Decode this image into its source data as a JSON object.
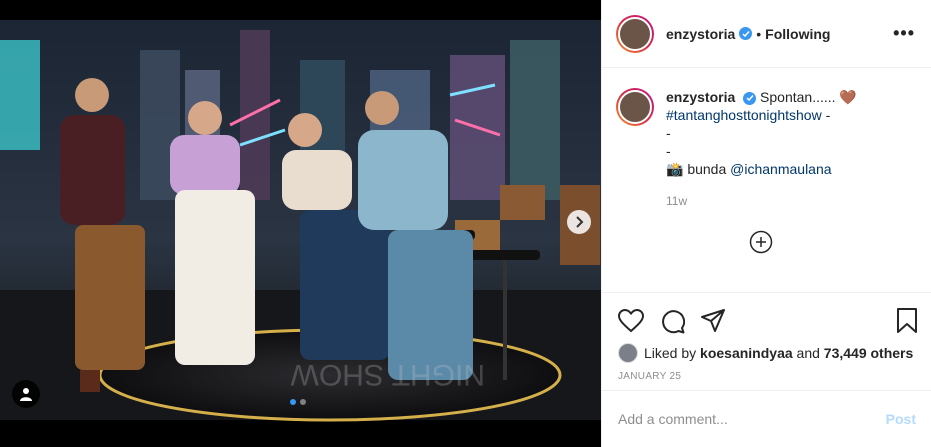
{
  "header": {
    "username": "enzystoria",
    "separator": "•",
    "follow_state": "Following",
    "more_label": "•••"
  },
  "caption": {
    "username": "enzystoria",
    "text": "Spontan......",
    "emoji": "🤎",
    "hashtag": "#tantanghosttonightshow",
    "dash1": "-",
    "dash2": "-",
    "dash3": "-",
    "camera_emoji": "📸",
    "credit_text": "bunda",
    "mention": "@ichanmaulana",
    "time_ago": "11w"
  },
  "likes": {
    "prefix": "Liked by",
    "user": "koesanindyaa",
    "and_text": "and",
    "count": "73,449 others"
  },
  "post_date": "JANUARY 25",
  "comment": {
    "placeholder": "Add a comment...",
    "post_label": "Post"
  },
  "carousel": {
    "total": 2,
    "active_index": 0
  },
  "colors": {
    "accent_blue": "#3897f0",
    "link_blue": "#00376b",
    "post_disabled": "#b3dbff",
    "muted": "#8e8e8e"
  },
  "icons": [
    "heart-icon",
    "comment-icon",
    "share-icon",
    "bookmark-icon",
    "add-circle-icon",
    "user-tag-icon",
    "chevron-right-icon",
    "verified-icon",
    "more-icon"
  ]
}
